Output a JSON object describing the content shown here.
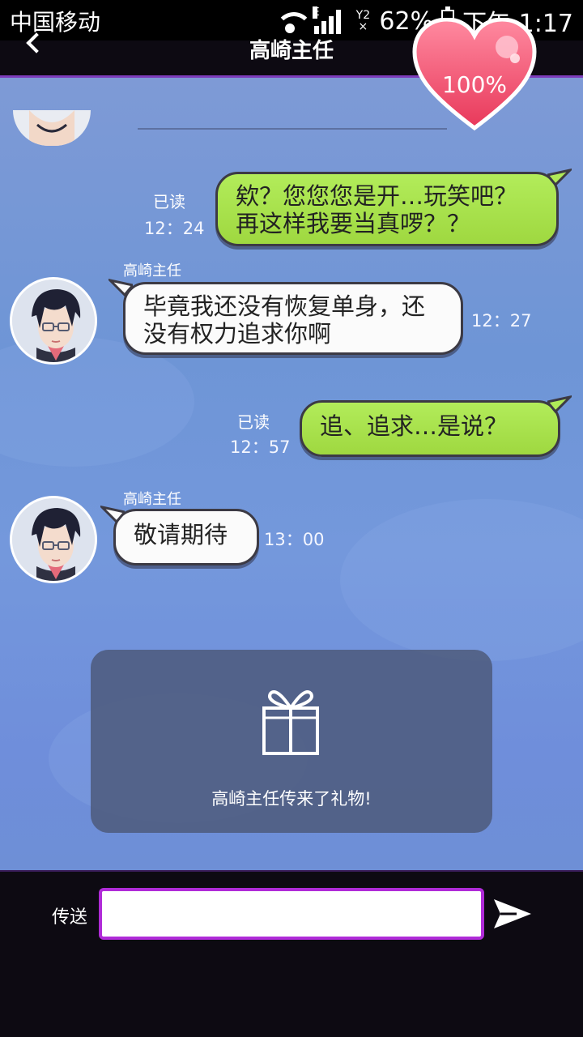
{
  "status_bar": {
    "carrier": "中国移动",
    "signal_type": "E",
    "sim_label": "Y2",
    "battery": "62%",
    "time": "下午 1:17"
  },
  "header": {
    "title": "高崎主任",
    "affection": "100%"
  },
  "messages": [
    {
      "side": "right",
      "read_label": "已读",
      "time": "12：24",
      "lines": [
        "欸？您您您是开…玩笑吧？",
        "再这样我要当真啰？？"
      ]
    },
    {
      "side": "left",
      "sender": "高崎主任",
      "time": "12：27",
      "lines": [
        "毕竟我还没有恢复单身，还",
        "没有权力追求你啊"
      ]
    },
    {
      "side": "right",
      "read_label": "已读",
      "time": "12：57",
      "lines": [
        "追、追求…是说？"
      ]
    },
    {
      "side": "left",
      "sender": "高崎主任",
      "time": "13：00",
      "lines": [
        "敬请期待"
      ]
    }
  ],
  "gift": {
    "text": "高崎主任传来了礼物!",
    "icon": "gift-icon"
  },
  "input_bar": {
    "send_label": "传送",
    "value": "",
    "send_icon": "send-arrow-icon"
  },
  "colors": {
    "green_bubble": "#a6df48",
    "input_border": "#b02bd8",
    "header_border": "#7d3dbb",
    "heart": "#ef4f6c"
  }
}
